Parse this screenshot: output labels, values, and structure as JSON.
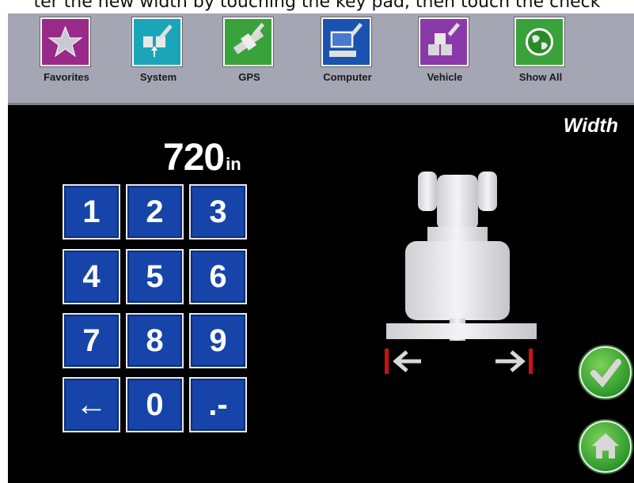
{
  "caption": "ter the new width by touching the key pad, then touch the check",
  "nav": [
    {
      "label": "Favorites",
      "icon": "star-icon",
      "color": "#9a2a8a"
    },
    {
      "label": "System",
      "icon": "system-wrench-icon",
      "color": "#1aa6b8"
    },
    {
      "label": "GPS",
      "icon": "satellite-icon",
      "color": "#3aa23a"
    },
    {
      "label": "Computer",
      "icon": "computer-icon",
      "color": "#1a52b0"
    },
    {
      "label": "Vehicle",
      "icon": "vehicle-blocks-icon",
      "color": "#8a3aa8"
    },
    {
      "label": "Show All",
      "icon": "globe-icon",
      "color": "#3aa23a"
    }
  ],
  "screen_title": "Width",
  "readout": {
    "value": "720",
    "unit": "in"
  },
  "keypad": [
    "1",
    "2",
    "3",
    "4",
    "5",
    "6",
    "7",
    "8",
    "9",
    "←",
    "0",
    ".-"
  ],
  "vehicle_icon": "tractor-topview-icon",
  "arrows": {
    "left": "left-arrow-icon",
    "right": "right-arrow-icon"
  },
  "buttons": {
    "confirm_icon": "checkmark-icon",
    "home_icon": "home-icon"
  },
  "colors": {
    "key_blue": "#1644a8",
    "green": "#2e9a2a",
    "width_marker": "#d01010"
  }
}
